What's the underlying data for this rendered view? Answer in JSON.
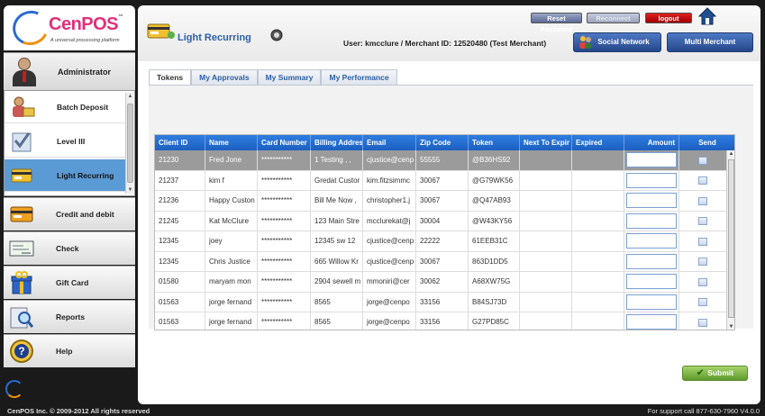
{
  "brand": {
    "logo_text": "CenPOS",
    "logo_tm": "™",
    "logo_subtitle": "A universal processing platform"
  },
  "sidebar": {
    "user_role": "Administrator",
    "submenu": [
      {
        "label": "Batch Deposit",
        "icon": "batch-deposit-icon"
      },
      {
        "label": "Level III",
        "icon": "level-iii-icon"
      },
      {
        "label": "Light Recurring",
        "icon": "light-recurring-icon",
        "active": true
      }
    ],
    "nav": [
      {
        "label": "Credit and debit",
        "icon": "credit-card-icon"
      },
      {
        "label": "Check",
        "icon": "check-icon"
      },
      {
        "label": "Gift Card",
        "icon": "gift-card-icon"
      },
      {
        "label": "Reports",
        "icon": "reports-icon"
      },
      {
        "label": "Help",
        "icon": "help-icon"
      }
    ]
  },
  "header": {
    "title": "Light Recurring",
    "user_info": "User: kmcclure / Merchant ID: 12520480 (Test Merchant)",
    "reset_password": "Reset Password",
    "reconnect": "Reconnect",
    "logout": "logout",
    "social_network": "Social Network",
    "multi_merchant": "Multi Merchant"
  },
  "tabs": [
    {
      "label": "Tokens",
      "active": true
    },
    {
      "label": "My Approvals"
    },
    {
      "label": "My Summary"
    },
    {
      "label": "My Performance"
    }
  ],
  "table": {
    "columns": [
      "Client ID",
      "Name",
      "Card Number",
      "Billing Addres",
      "Email",
      "Zip Code",
      "Token",
      "Next To Expir",
      "Expired",
      "Amount",
      "Send"
    ],
    "rows": [
      [
        "21230",
        "Fred Jone",
        "***********",
        "1 Testing , ,",
        "cjustice@cenp",
        "55555",
        "@B36HS92",
        "",
        ""
      ],
      [
        "21237",
        "kim f",
        "***********",
        "Gredat Custor",
        "kim.fitzsimmc",
        "30067",
        "@G79WK56",
        "",
        ""
      ],
      [
        "21236",
        "Happy Custon",
        "***********",
        "Bill Me Now ,",
        "christopher1.j",
        "30067",
        "@Q47AB93",
        "",
        ""
      ],
      [
        "21245",
        "Kat McClure",
        "***********",
        "123 Main Stre",
        "mcclurekat@j",
        "30004",
        "@W43KY56",
        "",
        ""
      ],
      [
        "12345",
        "joey",
        "***********",
        "12345 sw 12",
        "cjustice@cenp",
        "22222",
        "61EEB31C",
        "",
        ""
      ],
      [
        "12345",
        "Chris Justice",
        "***********",
        "665 Willow Kr",
        "cjustice@cenp",
        "30067",
        "863D1DD5",
        "",
        ""
      ],
      [
        "01580",
        "maryam mon",
        "***********",
        "2904 sewell m",
        "mmoniri@cer",
        "30062",
        "A68XW75G",
        "",
        ""
      ],
      [
        "01563",
        "jorge fernand",
        "***********",
        "8565",
        "jorge@cenpo",
        "33156",
        "B84SJ73D",
        "",
        ""
      ],
      [
        "01563",
        "jorge fernand",
        "***********",
        "8565",
        "jorge@cenpo",
        "33156",
        "G27PD85C",
        "",
        ""
      ]
    ],
    "selected_row": 0
  },
  "submit_label": "Submit",
  "footer": {
    "copyright": "CenPOS Inc. © 2009-2012 All rights reserved",
    "support": "For support call 877-630-7960  V4.0.0"
  },
  "colors": {
    "brand_pink": "#e0307a",
    "header_blue": "#1b5fc0",
    "active_nav": "#5b9bd5",
    "logout_red": "#c00000"
  }
}
